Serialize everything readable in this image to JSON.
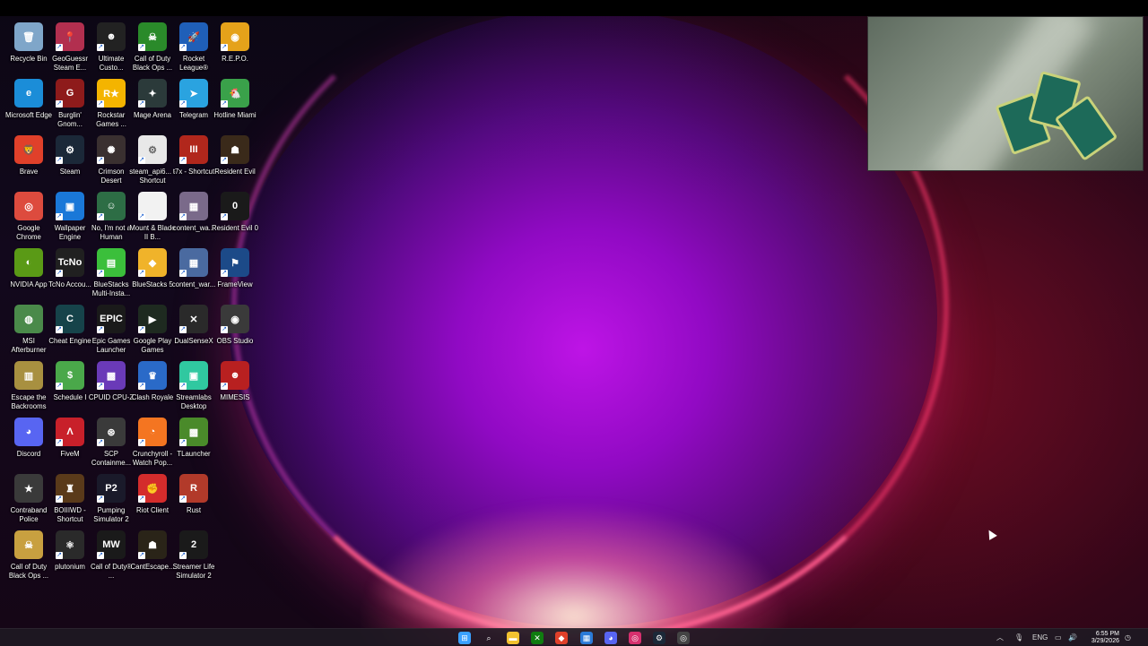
{
  "desktop": {
    "icons": [
      {
        "label": "Recycle Bin",
        "icon": "recycle-bin-icon",
        "color": "#7fa6c9",
        "glyph": "🗑",
        "shortcut": false
      },
      {
        "label": "GeoGuessr Steam E...",
        "icon": "geoguessr-icon",
        "color": "#b22f4f",
        "glyph": "📍",
        "shortcut": true
      },
      {
        "label": "Ultimate Custo...",
        "icon": "ultimate-custom-night-icon",
        "color": "#222",
        "glyph": "☻",
        "shortcut": true
      },
      {
        "label": "Call of Duty Black Ops ...",
        "icon": "cod-black-ops-icon",
        "color": "#2a8a2a",
        "glyph": "☠",
        "shortcut": true
      },
      {
        "label": "Rocket League®",
        "icon": "rocket-league-icon",
        "color": "#1f5fb8",
        "glyph": "🚀",
        "shortcut": true
      },
      {
        "label": "R.E.P.O.",
        "icon": "repo-icon",
        "color": "#e5a21a",
        "glyph": "◉",
        "shortcut": true
      },
      {
        "label": "Microsoft Edge",
        "icon": "edge-icon",
        "color": "#1b8dd8",
        "glyph": "e",
        "shortcut": false
      },
      {
        "label": "Burglin' Gnom...",
        "icon": "burglin-gnomes-icon",
        "color": "#8e1b1b",
        "glyph": "G",
        "shortcut": true
      },
      {
        "label": "Rockstar Games ...",
        "icon": "rockstar-icon",
        "color": "#f4b400",
        "glyph": "R★",
        "shortcut": true
      },
      {
        "label": "Mage Arena",
        "icon": "mage-arena-icon",
        "color": "#2b3a3a",
        "glyph": "✦",
        "shortcut": true
      },
      {
        "label": "Telegram",
        "icon": "telegram-icon",
        "color": "#2aa3e0",
        "glyph": "➤",
        "shortcut": true
      },
      {
        "label": "Hotline Miami",
        "icon": "hotline-miami-icon",
        "color": "#3aa14a",
        "glyph": "🐔",
        "shortcut": true
      },
      {
        "label": "Brave",
        "icon": "brave-icon",
        "color": "#e0402a",
        "glyph": "🦁",
        "shortcut": false
      },
      {
        "label": "Steam",
        "icon": "steam-icon",
        "color": "#1b2838",
        "glyph": "⚙",
        "shortcut": true
      },
      {
        "label": "Crimson Desert",
        "icon": "crimson-desert-icon",
        "color": "#3a3030",
        "glyph": "✺",
        "shortcut": true
      },
      {
        "label": "steam_api6... - Shortcut",
        "icon": "file-icon",
        "color": "#e8e8e8",
        "glyph": "⚙",
        "shortcut": true
      },
      {
        "label": "t7x - Shortcut",
        "icon": "t7x-icon",
        "color": "#b1271c",
        "glyph": "III",
        "shortcut": true
      },
      {
        "label": "Resident Evil",
        "icon": "resident-evil-icon",
        "color": "#3a2a1a",
        "glyph": "☗",
        "shortcut": true
      },
      {
        "label": "Google Chrome",
        "icon": "chrome-icon",
        "color": "#dd4b3e",
        "glyph": "◎",
        "shortcut": false
      },
      {
        "label": "Wallpaper Engine",
        "icon": "wallpaper-engine-icon",
        "color": "#1a78d8",
        "glyph": "▣",
        "shortcut": true
      },
      {
        "label": "No, I'm not a Human",
        "icon": "not-a-human-icon",
        "color": "#2d6d45",
        "glyph": "☺",
        "shortcut": true
      },
      {
        "label": "Mount & Blade II B...",
        "icon": "file-icon",
        "color": "#f2f2f2",
        "glyph": "",
        "shortcut": true
      },
      {
        "label": "content_wa...",
        "icon": "content-warning-icon",
        "color": "#7a6a8a",
        "glyph": "▦",
        "shortcut": true
      },
      {
        "label": "Resident Evil 0",
        "icon": "resident-evil-0-icon",
        "color": "#1a1a1a",
        "glyph": "0",
        "shortcut": true
      },
      {
        "label": "NVIDIA App",
        "icon": "nvidia-icon",
        "color": "#5a9a16",
        "glyph": "◐",
        "shortcut": false
      },
      {
        "label": "TcNo Accou...",
        "icon": "tcno-icon",
        "color": "#202020",
        "glyph": "TcNo",
        "shortcut": true
      },
      {
        "label": "BlueStacks Multi-Insta...",
        "icon": "bluestacks-multi-icon",
        "color": "#3bbf3b",
        "glyph": "▤",
        "shortcut": true
      },
      {
        "label": "BlueStacks 5",
        "icon": "bluestacks-icon",
        "color": "#f0b32a",
        "glyph": "◆",
        "shortcut": true
      },
      {
        "label": "content_war...",
        "icon": "content-warning-icon",
        "color": "#4a6aa0",
        "glyph": "▦",
        "shortcut": true
      },
      {
        "label": "FrameView",
        "icon": "frameview-icon",
        "color": "#1c4a88",
        "glyph": "⚑",
        "shortcut": true
      },
      {
        "label": "MSI Afterburner",
        "icon": "msi-afterburner-icon",
        "color": "#4a8a4a",
        "glyph": "◍",
        "shortcut": false
      },
      {
        "label": "Cheat Engine",
        "icon": "cheat-engine-icon",
        "color": "#16434a",
        "glyph": "C",
        "shortcut": true
      },
      {
        "label": "Epic Games Launcher",
        "icon": "epic-games-icon",
        "color": "#1a1a1a",
        "glyph": "EPIC",
        "shortcut": true
      },
      {
        "label": "Google Play Games",
        "icon": "google-play-games-icon",
        "color": "#1e2a20",
        "glyph": "▶",
        "shortcut": true
      },
      {
        "label": "DualSenseX",
        "icon": "dualsensex-icon",
        "color": "#2a2a2a",
        "glyph": "✕",
        "shortcut": true
      },
      {
        "label": "OBS Studio",
        "icon": "obs-icon",
        "color": "#3a3a3a",
        "glyph": "◉",
        "shortcut": true
      },
      {
        "label": "Escape the Backrooms",
        "icon": "escape-backrooms-icon",
        "color": "#a89040",
        "glyph": "▥",
        "shortcut": false
      },
      {
        "label": "Schedule I",
        "icon": "schedule-one-icon",
        "color": "#4aa84a",
        "glyph": "$",
        "shortcut": true
      },
      {
        "label": "CPUID CPU-Z",
        "icon": "cpu-z-icon",
        "color": "#6a3ab8",
        "glyph": "▩",
        "shortcut": true
      },
      {
        "label": "Clash Royale",
        "icon": "clash-royale-icon",
        "color": "#2a6ac8",
        "glyph": "♛",
        "shortcut": true
      },
      {
        "label": "Streamlabs Desktop",
        "icon": "streamlabs-icon",
        "color": "#30c8a0",
        "glyph": "▣",
        "shortcut": true
      },
      {
        "label": "MIMESIS",
        "icon": "mimesis-icon",
        "color": "#b82020",
        "glyph": "☻",
        "shortcut": true
      },
      {
        "label": "Discord",
        "icon": "discord-icon",
        "color": "#5865f2",
        "glyph": "◕",
        "shortcut": false
      },
      {
        "label": "FiveM",
        "icon": "fivem-icon",
        "color": "#c8202a",
        "glyph": "Λ",
        "shortcut": true
      },
      {
        "label": "SCP Containme...",
        "icon": "scp-icon",
        "color": "#3a3a3a",
        "glyph": "⊛",
        "shortcut": true
      },
      {
        "label": "Crunchyroll - Watch Pop...",
        "icon": "crunchyroll-icon",
        "color": "#f47521",
        "glyph": "◔",
        "shortcut": true
      },
      {
        "label": "TLauncher",
        "icon": "tlauncher-icon",
        "color": "#4a8a2a",
        "glyph": "▩",
        "shortcut": true
      },
      {
        "label": "Contraband Police",
        "icon": "contraband-police-icon",
        "color": "#3a3a3a",
        "glyph": "★",
        "shortcut": false
      },
      {
        "label": "BOIIIWD - Shortcut",
        "icon": "boiiiwd-icon",
        "color": "#5a3a1a",
        "glyph": "♜",
        "shortcut": true
      },
      {
        "label": "Pumping Simulator 2",
        "icon": "pumping-simulator-icon",
        "color": "#1a1a2a",
        "glyph": "P2",
        "shortcut": true
      },
      {
        "label": "Riot Client",
        "icon": "riot-client-icon",
        "color": "#d42c2c",
        "glyph": "✊",
        "shortcut": true
      },
      {
        "label": "Rust",
        "icon": "rust-icon",
        "color": "#b23a2a",
        "glyph": "R",
        "shortcut": true
      },
      {
        "label": "Call of Duty Black Ops ...",
        "icon": "cod-black-ops-2-icon",
        "color": "#c8a040",
        "glyph": "☠",
        "shortcut": false
      },
      {
        "label": "plutonium",
        "icon": "plutonium-icon",
        "color": "#2a2a2a",
        "glyph": "⚛",
        "shortcut": true
      },
      {
        "label": "Call of Duty® ...",
        "icon": "cod-mw-icon",
        "color": "#1a1a1a",
        "glyph": "MW",
        "shortcut": true
      },
      {
        "label": "CantEscape...",
        "icon": "cant-escape-icon",
        "color": "#2a2418",
        "glyph": "☗",
        "shortcut": true
      },
      {
        "label": "Streamer Life Simulator 2",
        "icon": "streamer-life-icon",
        "color": "#1a1a1a",
        "glyph": "2",
        "shortcut": true
      }
    ]
  },
  "taskbar": {
    "apps": [
      {
        "name": "start-button",
        "glyph": "⊞",
        "color": "#3aa0ff"
      },
      {
        "name": "search-icon",
        "glyph": "⌕",
        "color": "transparent"
      },
      {
        "name": "file-explorer-icon",
        "glyph": "▬",
        "color": "#f2c230"
      },
      {
        "name": "xbox-icon",
        "glyph": "✕",
        "color": "#107c10"
      },
      {
        "name": "brave-taskbar-icon",
        "glyph": "◆",
        "color": "#e0402a"
      },
      {
        "name": "microsoft-store-icon",
        "glyph": "▦",
        "color": "#2a7ad8"
      },
      {
        "name": "discord-taskbar-icon",
        "glyph": "◕",
        "color": "#5865f2"
      },
      {
        "name": "instagram-icon",
        "glyph": "◎",
        "color": "#d6306e"
      },
      {
        "name": "steam-taskbar-icon",
        "glyph": "⚙",
        "color": "#1b2838"
      },
      {
        "name": "chrome-taskbar-icon",
        "glyph": "◎",
        "color": "#444"
      }
    ],
    "tray": {
      "language": "ENG",
      "time": "6:55 PM",
      "date": "3/29/2026"
    }
  }
}
